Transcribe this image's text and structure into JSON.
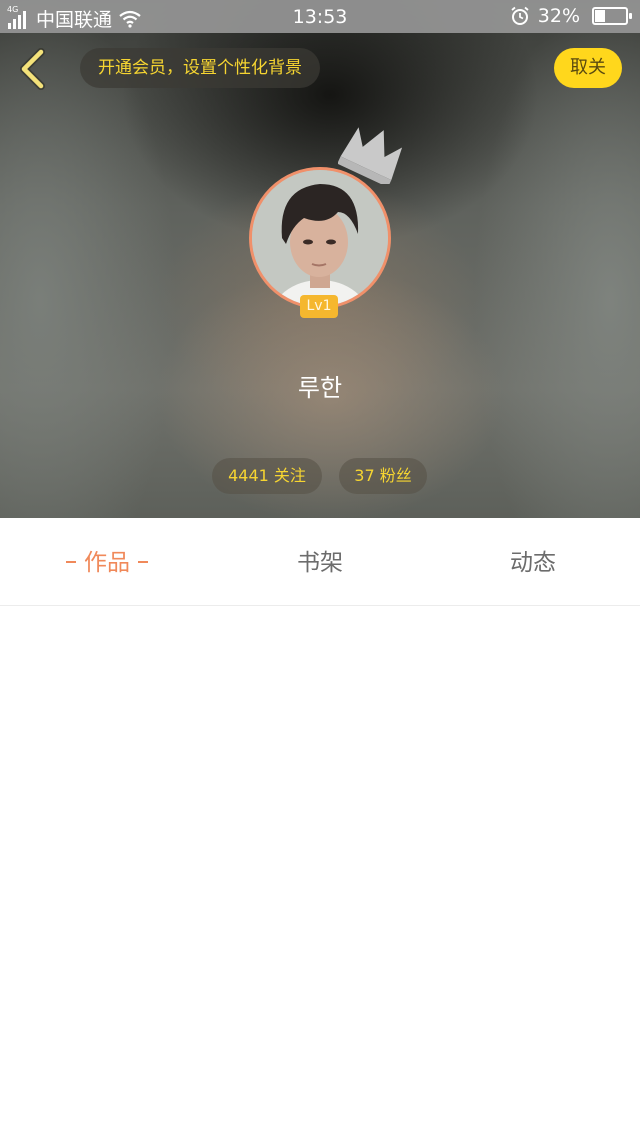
{
  "status_bar": {
    "network_type": "4G",
    "carrier": "中国联通",
    "time": "13:53",
    "battery_percent": "32%",
    "battery_level": 0.32,
    "icons": [
      "signal-icon",
      "wifi-icon",
      "alarm-icon",
      "battery-icon"
    ]
  },
  "header": {
    "back_icon": "chevron-left-icon",
    "vip_banner": "开通会员，设置个性化背景",
    "unfollow_label": "取关"
  },
  "profile": {
    "avatar": "user-avatar",
    "crown_icon": "crown-icon",
    "level": "Lv1",
    "username": "루한",
    "following": "4441 关注",
    "fans": "37 粉丝"
  },
  "tabs": [
    {
      "label": "作品",
      "active": true
    },
    {
      "label": "书架",
      "active": false
    },
    {
      "label": "动态",
      "active": false
    }
  ],
  "colors": {
    "accent_yellow": "#ffd71c",
    "stat_text": "#f6d531",
    "active_tab": "#f0895a",
    "avatar_ring": "#f0906a",
    "level_badge": "#f5b72e"
  }
}
